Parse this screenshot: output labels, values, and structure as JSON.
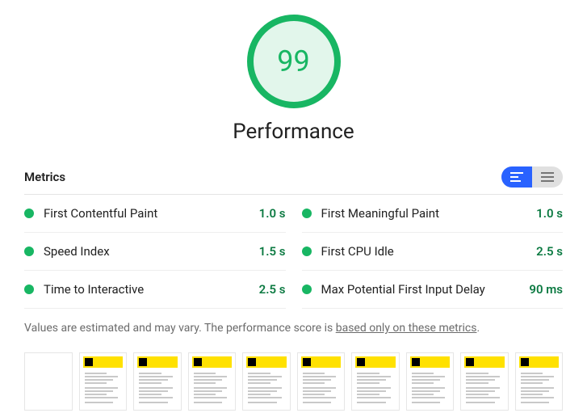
{
  "gauge": {
    "score": "99",
    "title": "Performance"
  },
  "metrics_label": "Metrics",
  "metrics": [
    {
      "name": "First Contentful Paint",
      "value": "1.0 s"
    },
    {
      "name": "First Meaningful Paint",
      "value": "1.0 s"
    },
    {
      "name": "Speed Index",
      "value": "1.5 s"
    },
    {
      "name": "First CPU Idle",
      "value": "2.5 s"
    },
    {
      "name": "Time to Interactive",
      "value": "2.5 s"
    },
    {
      "name": "Max Potential First Input Delay",
      "value": "90 ms"
    }
  ],
  "footnote": {
    "prefix": "Values are estimated and may vary. The performance score is ",
    "link": "based only on these metrics",
    "suffix": "."
  },
  "colors": {
    "pass": "#18b663",
    "accent": "#2962ff"
  },
  "filmstrip_count": 10,
  "filmstrip_first_blank": true
}
